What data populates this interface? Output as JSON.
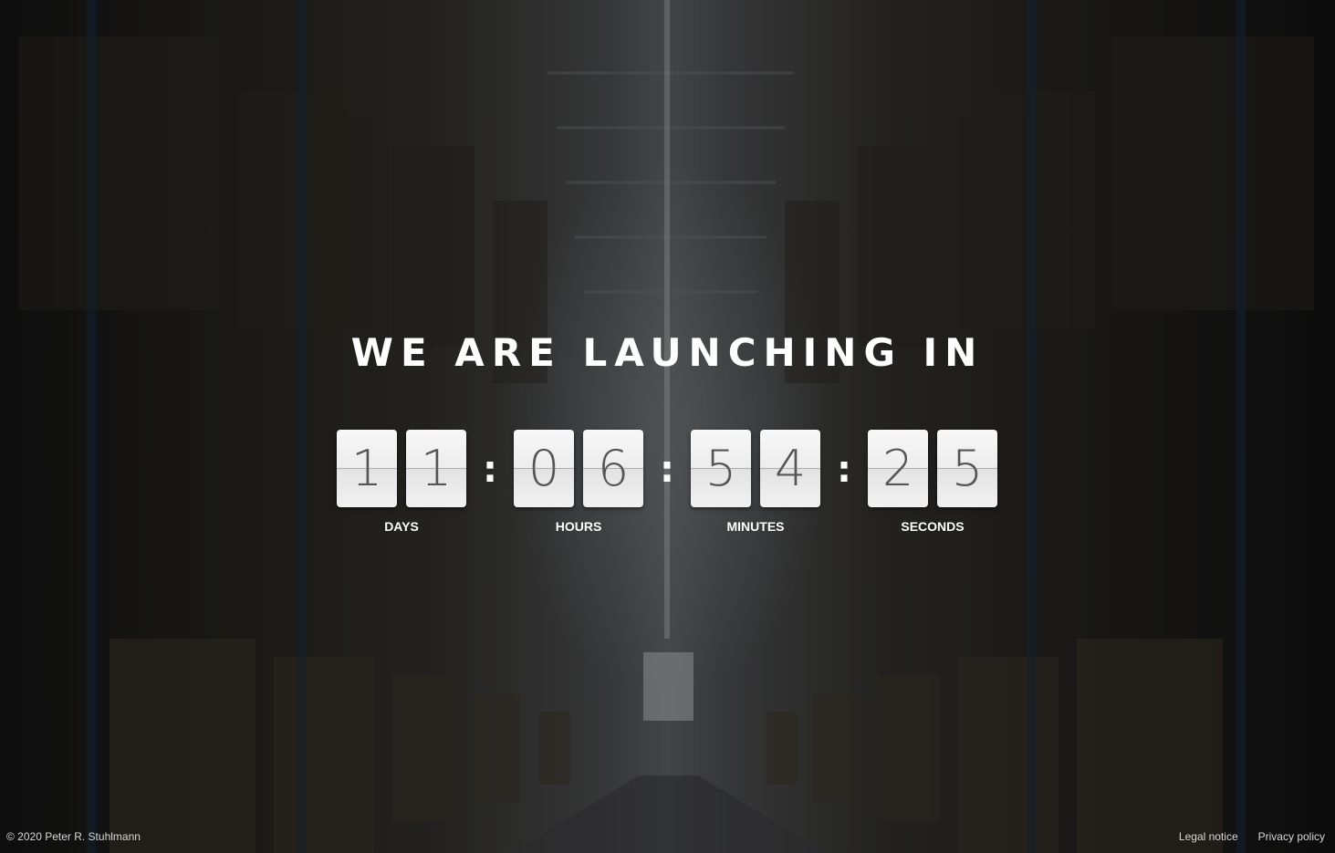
{
  "headline": "WE ARE LAUNCHING IN",
  "countdown": {
    "days": {
      "digits": [
        "1",
        "1"
      ],
      "label": "DAYS"
    },
    "hours": {
      "digits": [
        "0",
        "6"
      ],
      "label": "HOURS"
    },
    "minutes": {
      "digits": [
        "5",
        "4"
      ],
      "label": "MINUTES"
    },
    "seconds": {
      "digits": [
        "2",
        "5"
      ],
      "label": "SECONDS"
    },
    "separator": ":"
  },
  "footer": {
    "copyright": "© 2020 Peter R. Stuhlmann",
    "links": [
      "Legal notice",
      "Privacy policy"
    ]
  }
}
